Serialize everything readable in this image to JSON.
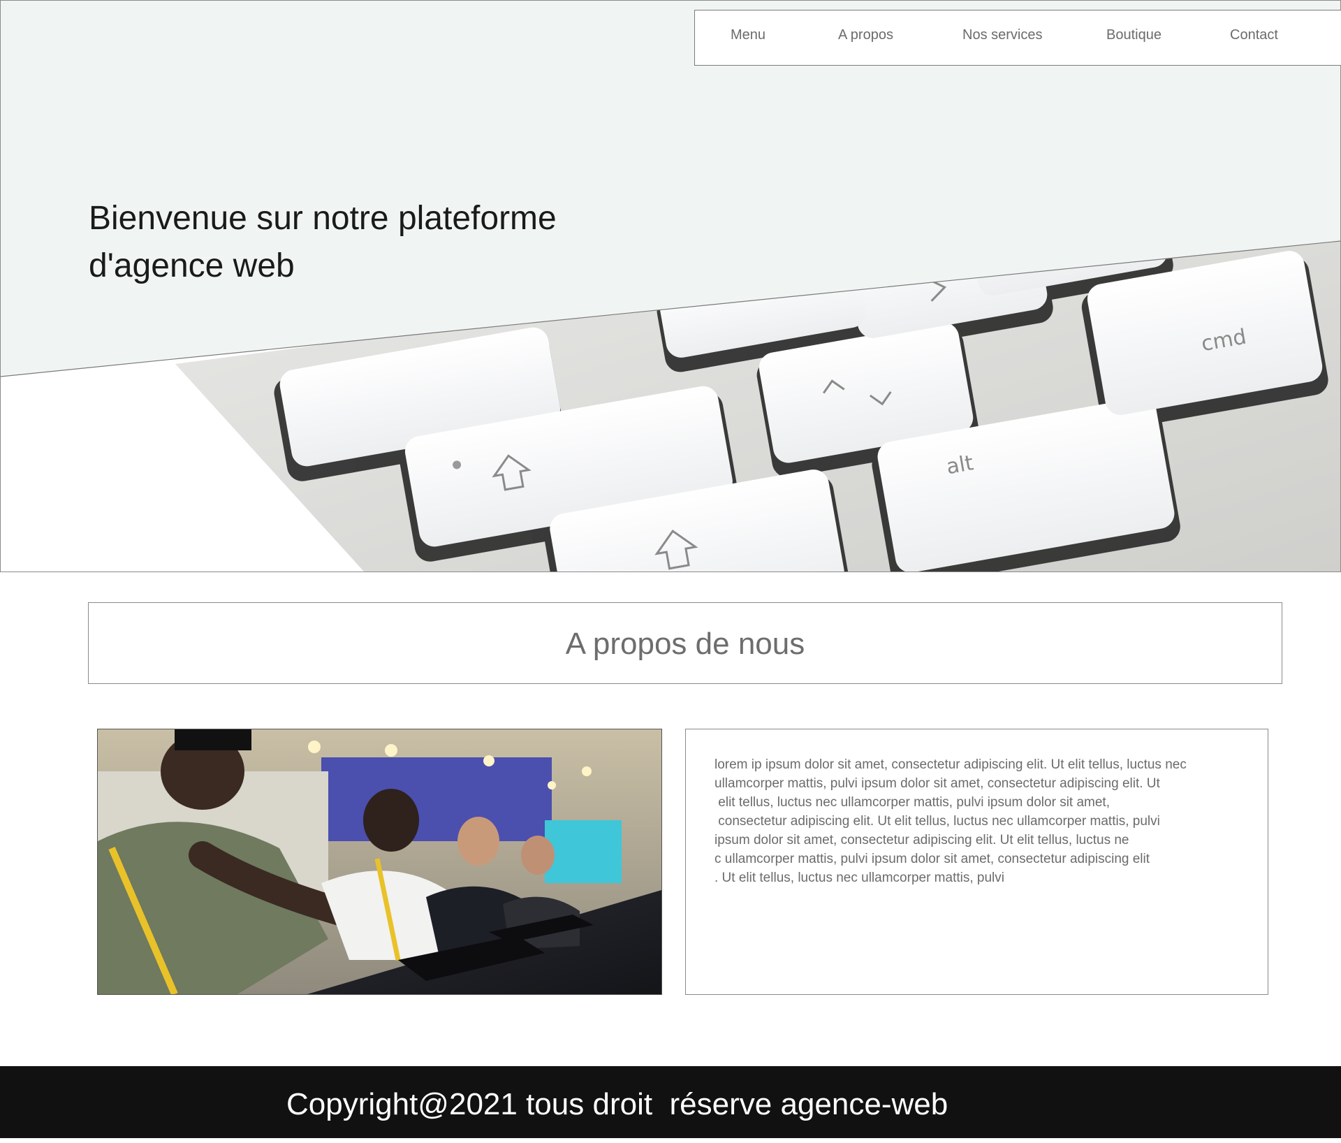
{
  "nav": {
    "items": [
      "Menu",
      "A propos",
      "Nos services",
      "Boutique",
      "Contact"
    ]
  },
  "hero": {
    "title_line1": "Bienvenue sur notre plateforme",
    "title_line2": "d'agence web",
    "image": "keyboard-keys-photo",
    "band_color": "#f0f5f4"
  },
  "about": {
    "title": "A propos de nous",
    "image": "call-center-operators-photo",
    "paragraph_lines": [
      "lorem ip ipsum dolor sit amet, consectetur adipiscing elit. Ut elit tellus, luctus nec",
      "ullamcorper mattis, pulvi ipsum dolor sit amet, consectetur adipiscing elit. Ut",
      " elit tellus, luctus nec ullamcorper mattis, pulvi ipsum dolor sit amet,",
      " consectetur adipiscing elit. Ut elit tellus, luctus nec ullamcorper mattis, pulvi",
      "ipsum dolor sit amet, consectetur adipiscing elit. Ut elit tellus, luctus ne",
      "c ullamcorper mattis, pulvi ipsum dolor sit amet, consectetur adipiscing elit",
      ". Ut elit tellus, luctus nec ullamcorper mattis, pulvi"
    ]
  },
  "footer": {
    "text": "Copyright@2021 tous droit  réserve agence-web",
    "background": "#111111"
  }
}
